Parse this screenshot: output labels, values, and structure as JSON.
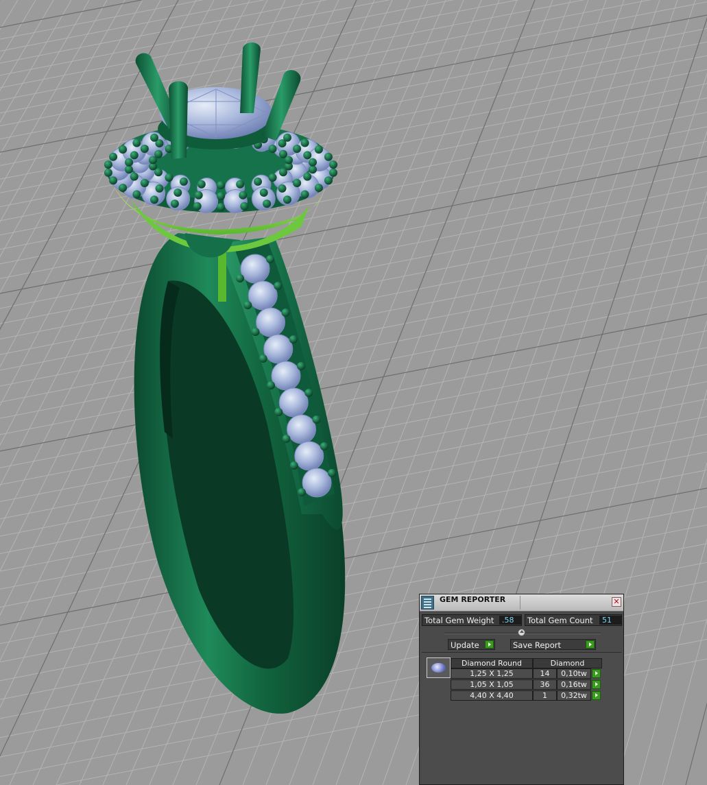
{
  "gem_reporter": {
    "title": "GEM REPORTER",
    "close_symbol": "✕",
    "total_gem_weight_label": "Total Gem Weight",
    "total_gem_weight_value": ".58",
    "total_gem_count_label": "Total Gem Count",
    "total_gem_count_value": "51",
    "update_label": "Update",
    "save_report_label": "Save Report",
    "columns": [
      "Diamond Round",
      "Diamond"
    ],
    "rows": [
      {
        "size": "1,25 X 1,25",
        "count": "14",
        "weight": "0,10tw"
      },
      {
        "size": "1,05 X 1,05",
        "count": "36",
        "weight": "0,16tw"
      },
      {
        "size": "4,40 X 4,40",
        "count": "1",
        "weight": "0,32tw"
      }
    ]
  },
  "colors": {
    "metal_dark": "#0f5a3a",
    "metal_mid": "#1b7a50",
    "head_lime": "#7fd44a",
    "stone": "#a9b8dc",
    "grid": "#9a9a9a",
    "accent_green": "#3b9b1f",
    "value_text": "#7fd8f5"
  }
}
